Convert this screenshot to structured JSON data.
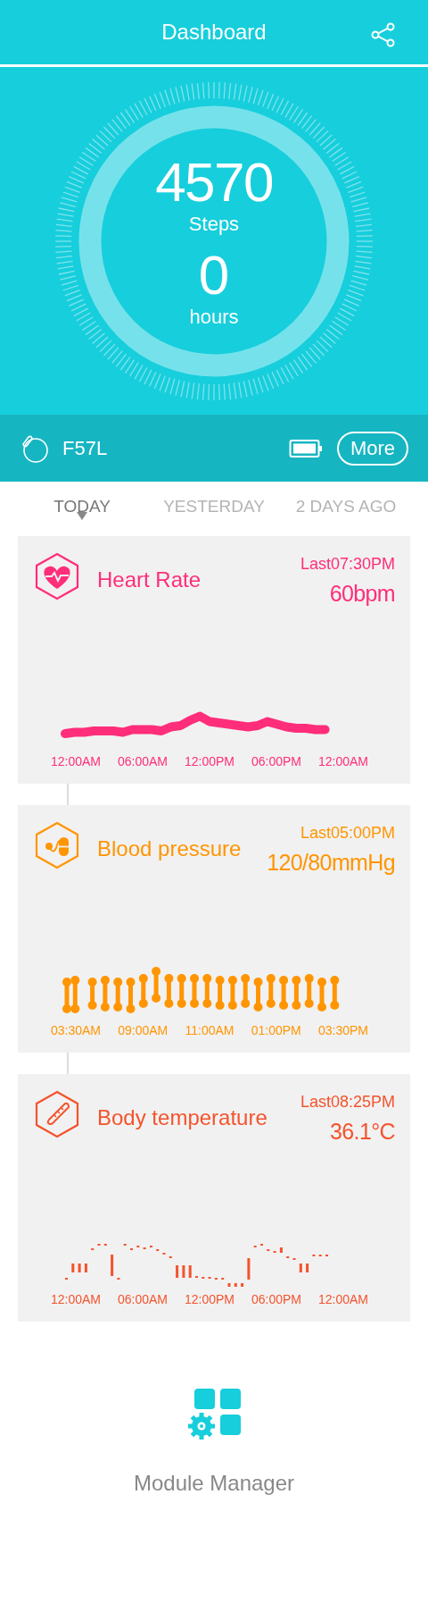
{
  "header": {
    "title": "Dashboard"
  },
  "summary": {
    "steps": "4570",
    "steps_label": "Steps",
    "hours": "0",
    "hours_label": "hours"
  },
  "device": {
    "name": "F57L",
    "more_button": "More"
  },
  "tabs": [
    {
      "label": "TODAY",
      "selected": true
    },
    {
      "label": "YESTERDAY",
      "selected": false
    },
    {
      "label": "2 DAYS AGO",
      "selected": false
    }
  ],
  "cards": [
    {
      "kind": "heart",
      "title": "Heart Rate",
      "color": "#ff2d7a",
      "last": "Last07:30PM",
      "value": "60bpm",
      "x_labels": [
        "12:00AM",
        "06:00AM",
        "12:00PM",
        "06:00PM",
        "12:00AM"
      ]
    },
    {
      "kind": "pressure",
      "title": "Blood pressure",
      "color": "#ff9500",
      "last": "Last05:00PM",
      "value": "120/80mmHg",
      "x_labels": [
        "03:30AM",
        "09:00AM",
        "11:00AM",
        "01:00PM",
        "03:30PM"
      ]
    },
    {
      "kind": "temperature",
      "title": "Body temperature",
      "color": "#f4532d",
      "last": "Last08:25PM",
      "value": "36.1°C",
      "x_labels": [
        "12:00AM",
        "06:00AM",
        "12:00PM",
        "06:00PM",
        "12:00AM"
      ]
    }
  ],
  "module_manager": {
    "label": "Module Manager"
  }
}
